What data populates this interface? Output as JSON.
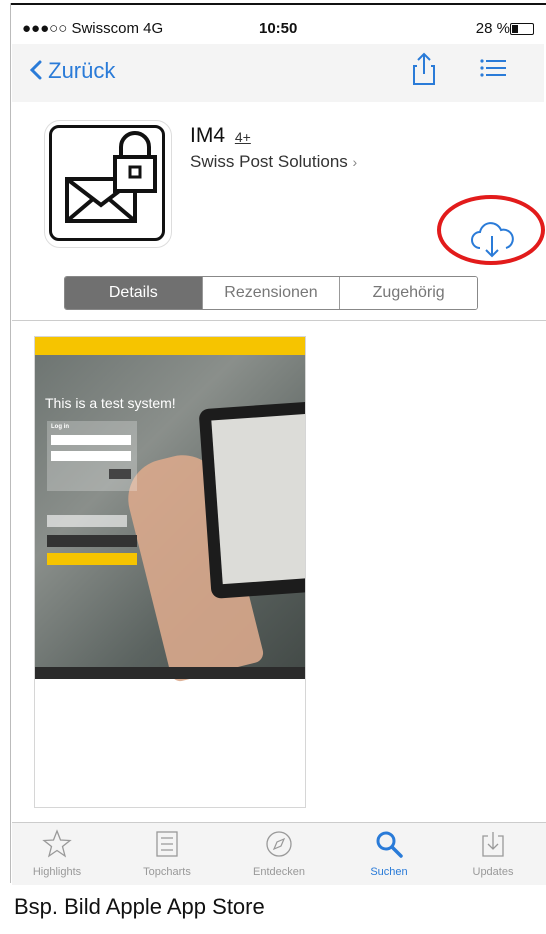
{
  "status": {
    "carrier": "●●●○○ Swisscom  4G",
    "time": "10:50",
    "battery": "28 %"
  },
  "nav": {
    "back_label": "Zurück"
  },
  "app": {
    "title": "IM4",
    "age_rating": "4+",
    "developer": "Swiss Post Solutions"
  },
  "segments": [
    "Details",
    "Rezensionen",
    "Zugehörig"
  ],
  "screenshot": {
    "headline": "This is a test system!",
    "login_label": "Log in"
  },
  "tabs": [
    {
      "label": "Highlights",
      "icon": "star-icon"
    },
    {
      "label": "Topcharts",
      "icon": "list-icon"
    },
    {
      "label": "Entdecken",
      "icon": "compass-icon"
    },
    {
      "label": "Suchen",
      "icon": "search-icon"
    },
    {
      "label": "Updates",
      "icon": "download-icon"
    }
  ],
  "caption": "Bsp. Bild Apple App Store",
  "colors": {
    "accent": "#2a7bd8",
    "highlight": "#e21b1b",
    "segment_active": "#707070"
  }
}
